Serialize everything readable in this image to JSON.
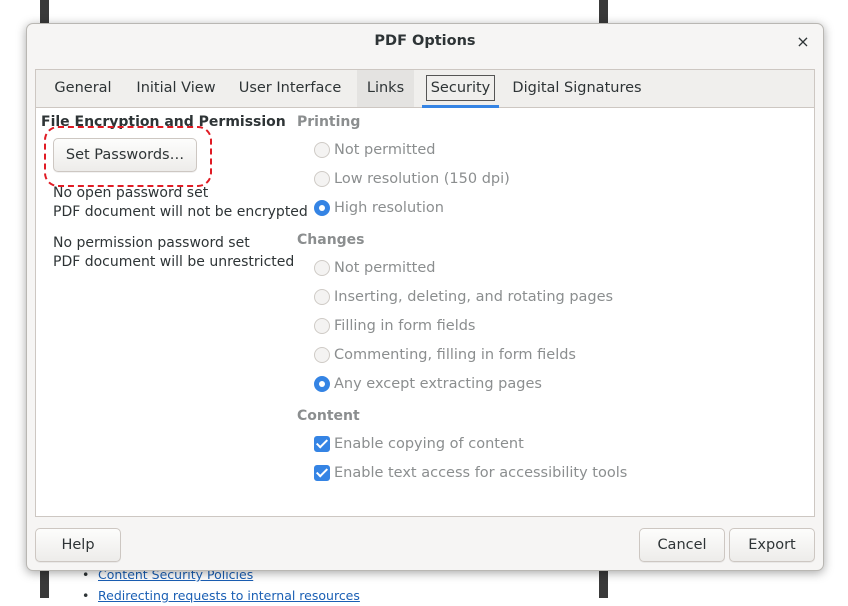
{
  "background": {
    "links": [
      "Content Security Policies",
      "Redirecting requests to internal resources"
    ]
  },
  "dialog": {
    "title": "PDF Options",
    "close_glyph": "×",
    "tabs": [
      "General",
      "Initial View",
      "User Interface",
      "Links",
      "Security",
      "Digital Signatures"
    ],
    "active_tab": "Security"
  },
  "encryption": {
    "title": "File Encryption and Permission",
    "set_passwords": "Set Passwords…",
    "open_status_1": "No open password set",
    "open_status_2": "PDF document will not be encrypted",
    "perm_status_1": "No permission password set",
    "perm_status_2": "PDF document will be unrestricted"
  },
  "printing": {
    "title": "Printing",
    "options": [
      "Not permitted",
      "Low resolution (150 dpi)",
      "High resolution"
    ],
    "selected": "High resolution"
  },
  "changes": {
    "title": "Changes",
    "options": [
      "Not permitted",
      "Inserting, deleting, and rotating pages",
      "Filling in form fields",
      "Commenting, filling in form fields",
      "Any except extracting pages"
    ],
    "selected": "Any except extracting pages"
  },
  "content": {
    "title": "Content",
    "options": [
      "Enable copying of content",
      "Enable text access for accessibility tools"
    ],
    "checked": [
      true,
      true
    ]
  },
  "footer": {
    "help": "Help",
    "cancel": "Cancel",
    "export": "Export"
  },
  "colors": {
    "accent": "#3584e4",
    "highlight": "#e01b24"
  }
}
